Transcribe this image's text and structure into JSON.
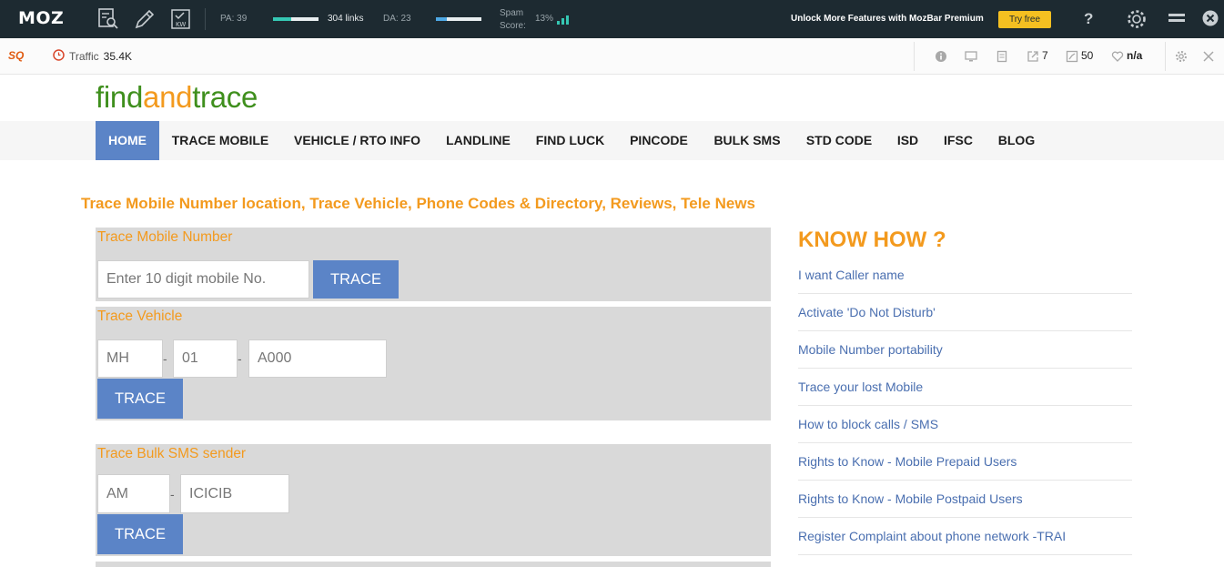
{
  "mozbar": {
    "logo": "MOZ",
    "pa_label": "PA: 39",
    "links_label": "304 links",
    "da_label": "DA: 23",
    "spam_label_line1": "Spam",
    "spam_label_line2": "Score:",
    "spam_value": "13%",
    "premium_text": "Unlock More Features with MozBar Premium",
    "try_free": "Try free",
    "help": "?",
    "colors": {
      "bg": "#1d2a31",
      "accent": "#f5c021",
      "pa_bar": "#35c7b3",
      "da_bar": "#4ea8e4"
    }
  },
  "subbar": {
    "sq_logo": "SQ",
    "traffic_label": "Traffic",
    "traffic_value": "35.4K",
    "external_links": "7",
    "followed": "50",
    "health": "n/a"
  },
  "site": {
    "logo": {
      "part1": "find",
      "part2": "and",
      "part3": "trace"
    },
    "nav": [
      {
        "label": "HOME"
      },
      {
        "label": "TRACE MOBILE"
      },
      {
        "label": "VEHICLE / RTO INFO"
      },
      {
        "label": "LANDLINE"
      },
      {
        "label": "FIND LUCK"
      },
      {
        "label": "PINCODE"
      },
      {
        "label": "BULK SMS"
      },
      {
        "label": "STD CODE"
      },
      {
        "label": "ISD"
      },
      {
        "label": "IFSC"
      },
      {
        "label": "BLOG"
      }
    ],
    "tagline": "Trace Mobile Number location, Trace Vehicle, Phone Codes & Directory, Reviews, Tele News",
    "trace_mobile": {
      "title": "Trace Mobile Number",
      "placeholder": "Enter 10 digit mobile No.",
      "button": "TRACE"
    },
    "trace_vehicle": {
      "title": "Trace Vehicle",
      "state_placeholder": "MH",
      "district_placeholder": "01",
      "number_placeholder": "A000",
      "dash": "-",
      "button": "TRACE"
    },
    "bulk_sms": {
      "title": "Trace Bulk SMS sender",
      "prefix_placeholder": "AM",
      "sender_placeholder": "ICICIB",
      "dash": "-",
      "button": "TRACE"
    },
    "know_how": {
      "title": "KNOW HOW ?",
      "links": [
        "I want Caller name",
        "Activate 'Do Not Disturb'",
        "Mobile Number portability",
        "Trace your lost Mobile",
        "How to block calls / SMS",
        "Rights to Know - Mobile Prepaid Users",
        "Rights to Know - Mobile Postpaid Users",
        "Register Complaint about phone network -TRAI"
      ]
    },
    "colors": {
      "accent_orange": "#f39a1e",
      "brand_green": "#3f8f1d",
      "button_blue": "#5b84c7",
      "link_blue": "#4a6fb0"
    }
  }
}
